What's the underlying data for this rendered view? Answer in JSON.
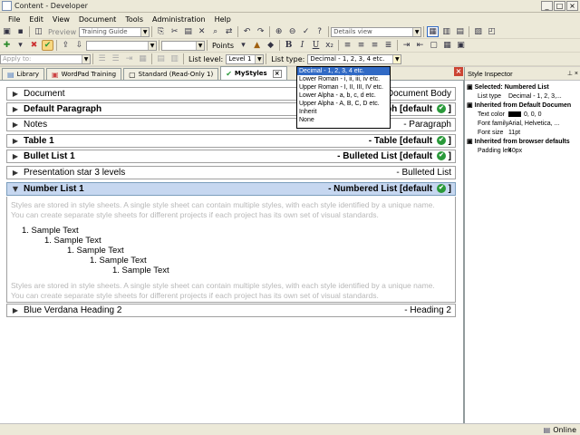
{
  "window": {
    "title": "Content - Developer"
  },
  "menu": [
    "File",
    "Edit",
    "View",
    "Document",
    "Tools",
    "Administration",
    "Help"
  ],
  "toolbar": {
    "preview_label": "Preview",
    "template_value": "Training Guide",
    "view_value": "Details view",
    "points_label": "Points",
    "apply_to_label": "Apply to:",
    "list_level_label": "List level:",
    "list_level_value": "Level 1",
    "list_type_label": "List type:",
    "list_type_value": "Decimal - 1, 2, 3, 4 etc.",
    "bold": "B",
    "italic": "I",
    "underline": "U"
  },
  "tabs": [
    {
      "label": "Library"
    },
    {
      "label": "WordPad Training"
    },
    {
      "label": "Standard (Read-Only 1)"
    },
    {
      "label": "MyStyles"
    }
  ],
  "list_type_options": [
    "Decimal - 1, 2, 3, 4 etc.",
    "Lower Roman - i, ii, iii, iv etc.",
    "Upper Roman - I, II, III, IV etc.",
    "Lower Alpha - a, b, c, d etc.",
    "Upper Alpha - A, B, C, D etc.",
    "Inherit",
    "None"
  ],
  "styles": [
    {
      "name": "Document",
      "type": "Document Body"
    },
    {
      "name": "Default Paragraph",
      "type": "ph [default"
    },
    {
      "name": "Notes",
      "type": "- Paragraph"
    },
    {
      "name": "Table 1",
      "type": "- Table [default"
    },
    {
      "name": "Bullet List 1",
      "type": "- Bulleted List [default"
    },
    {
      "name": "Presentation star 3 levels",
      "type": "- Bulleted List"
    },
    {
      "name": "Number List 1",
      "type": "- Numbered List [default"
    },
    {
      "name": "Blue Verdana Heading 2",
      "type": "- Heading 2"
    }
  ],
  "bracket_close": "]",
  "preview": {
    "paragraph": "Styles are stored in style sheets. A single style sheet can contain multiple styles, with each style identified by a unique name. You can create separate style sheets for different projects if each project has its own set of visual standards.",
    "list_items": [
      "1.  Sample Text",
      "1.  Sample Text",
      "1.  Sample Text",
      "1.  Sample Text",
      "1.  Sample Text"
    ]
  },
  "inspector": {
    "title": "Style Inspector",
    "sections": [
      {
        "heading": "Selected: Numbered List",
        "rows": [
          {
            "k": "List type",
            "v": "Decimal - 1, 2, 3,..."
          }
        ]
      },
      {
        "heading": "Inherited from Default Documen",
        "rows": [
          {
            "k": "Text color",
            "v": "0, 0, 0"
          },
          {
            "k": "Font family",
            "v": "Arial, Helvetica, ..."
          },
          {
            "k": "Font size",
            "v": "11pt"
          }
        ]
      },
      {
        "heading": "Inherited from browser defaults",
        "rows": [
          {
            "k": "Padding left",
            "v": "40px"
          }
        ]
      }
    ]
  },
  "status": {
    "text": "Online"
  },
  "colors": {
    "selected_row": "#c6d7f0",
    "dropdown_selected": "#316ac5",
    "check_green": "#2a9a3a"
  }
}
